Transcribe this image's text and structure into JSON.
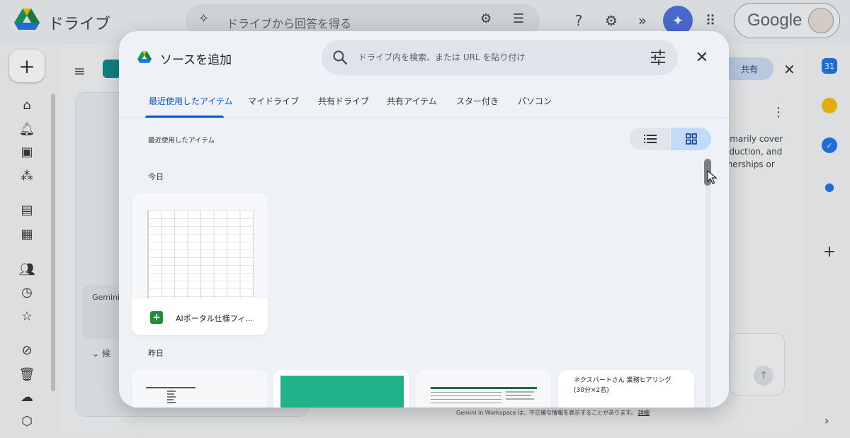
{
  "app": {
    "name": "ドライブ",
    "search_placeholder": "ドライブから回答を得る",
    "account_label": "Google"
  },
  "background": {
    "gemini_label": "Gemini i",
    "collapsed_label": "候",
    "share_label": "共有",
    "right_text": [
      "rimarily cover",
      "oduction, and",
      "tnerships or"
    ],
    "footer_text": "Gemini in Workspace は、不正確な情報を表示することがあります。",
    "footer_link": "詳細"
  },
  "dialog": {
    "title": "ソースを追加",
    "search_placeholder": "ドライブ内を検索、または URL を貼り付け",
    "tabs": [
      {
        "label": "最近使用したアイテム",
        "active": true
      },
      {
        "label": "マイドライブ",
        "active": false
      },
      {
        "label": "共有ドライブ",
        "active": false
      },
      {
        "label": "共有アイテム",
        "active": false
      },
      {
        "label": "スター付き",
        "active": false
      },
      {
        "label": "パソコン",
        "active": false
      }
    ],
    "section_label": "最近使用したアイテム",
    "view_mode": "grid",
    "groups": [
      {
        "label": "今日",
        "files": [
          {
            "name": "AIポータル仕様フィ...",
            "type": "spreadsheet",
            "icon": "sheets-icon"
          }
        ]
      },
      {
        "label": "昨日",
        "files": [
          {
            "name": "",
            "type": "document"
          },
          {
            "name": "",
            "type": "green-cover"
          },
          {
            "name": "",
            "type": "spreadsheet"
          },
          {
            "name": "",
            "type": "document",
            "preview_text": "ネクスパートさん 業務ヒアリング(30分×2名)"
          }
        ]
      }
    ]
  },
  "colors": {
    "accent": "#0b57d0",
    "dialog_bg": "#eef1f6",
    "sheets_green": "#1e8e3e",
    "cover_green": "#20b38a"
  }
}
